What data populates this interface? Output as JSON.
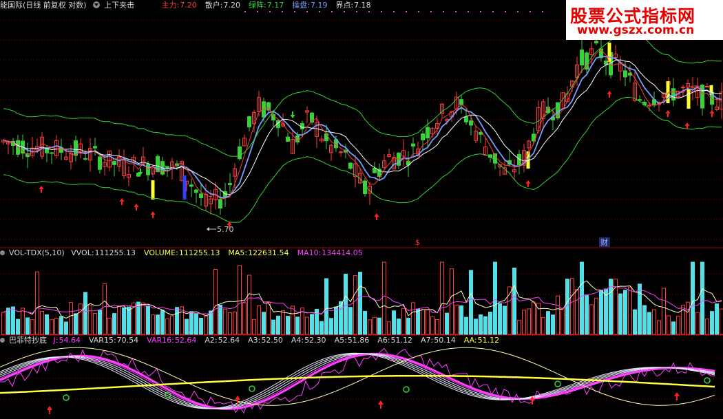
{
  "header": {
    "title": "能国际(日线 前复权 对数)",
    "formula_name": "上下夹击",
    "readouts": [
      {
        "label": "主力:",
        "value": "7.20",
        "color": "#ff3c3c"
      },
      {
        "label": "散户:",
        "value": "7.20",
        "color": "#d8d8d8"
      },
      {
        "label": "绿阵:",
        "value": "7.17",
        "color": "#36d236"
      },
      {
        "label": "操盘:",
        "value": "7.19",
        "color": "#7aa0ff"
      },
      {
        "label": "界点:",
        "value": "7.18",
        "color": "#d8d8d8"
      }
    ]
  },
  "watermark": {
    "title": "股票公式指标网",
    "url": "www.gszx.com.cn"
  },
  "markers": {
    "low_label": "5.70",
    "event_s": "$",
    "event_cai": "财"
  },
  "volume_header": {
    "name": "VOL-TDX(5,10)",
    "items": [
      {
        "label": "VVOL:",
        "value": "111255.13",
        "color": "#d8d8d8"
      },
      {
        "label": "VOLUME:",
        "value": "111255.13",
        "color": "#ffff40"
      },
      {
        "label": "MA5:",
        "value": "122631.54",
        "color": "#ffff40"
      },
      {
        "label": "MA10:",
        "value": "134414.05",
        "color": "#ff40ff"
      }
    ]
  },
  "osc_header": {
    "name": "巴菲特抄底",
    "items": [
      {
        "label": "J:",
        "value": "54.64",
        "color": "#ff40ff"
      },
      {
        "label": "VAR15:",
        "value": "70.54",
        "color": "#d8d8d8"
      },
      {
        "label": "VAR16:",
        "value": "52.64",
        "color": "#ff40ff"
      },
      {
        "label": "A2:",
        "value": "52.64",
        "color": "#d8d8d8"
      },
      {
        "label": "A3:",
        "value": "52.50",
        "color": "#d8d8d8"
      },
      {
        "label": "A4:",
        "value": "52.30",
        "color": "#d8d8d8"
      },
      {
        "label": "A5:",
        "value": "51.86",
        "color": "#d8d8d8"
      },
      {
        "label": "A6:",
        "value": "51.12",
        "color": "#d8d8d8"
      },
      {
        "label": "A7:",
        "value": "50.14",
        "color": "#d8d8d8"
      },
      {
        "label": "AA:",
        "value": "51.12",
        "color": "#ffff40"
      }
    ]
  },
  "chart_data": [
    {
      "type": "candlestick",
      "series": [
        {
          "name": "主力",
          "color": "#ff3c3c",
          "last": 7.2
        },
        {
          "name": "散户",
          "color": "#d8d8d8",
          "last": 7.2
        },
        {
          "name": "绿阵",
          "color": "#36d236",
          "last": 7.17
        },
        {
          "name": "操盘",
          "color": "#7aa0ff",
          "last": 7.19
        },
        {
          "name": "界点",
          "color": "#d8d8d8",
          "last": 7.18
        }
      ],
      "low_annotation": 5.7,
      "scale": "log"
    },
    {
      "type": "bar",
      "series": [
        {
          "name": "VVOL",
          "last": 111255.13
        },
        {
          "name": "VOLUME",
          "last": 111255.13
        },
        {
          "name": "MA5",
          "last": 122631.54
        },
        {
          "name": "MA10",
          "last": 134414.05
        }
      ]
    },
    {
      "type": "line",
      "series": [
        {
          "name": "J",
          "last": 54.64
        },
        {
          "name": "VAR15",
          "last": 70.54
        },
        {
          "name": "VAR16",
          "last": 52.64
        },
        {
          "name": "A2",
          "last": 52.64
        },
        {
          "name": "A3",
          "last": 52.5
        },
        {
          "name": "A4",
          "last": 52.3
        },
        {
          "name": "A5",
          "last": 51.86
        },
        {
          "name": "A6",
          "last": 51.12
        },
        {
          "name": "A7",
          "last": 50.14
        },
        {
          "name": "AA",
          "last": 51.12
        }
      ]
    }
  ],
  "colors": {
    "up": "#ff3c3c",
    "down": "#54e0e8",
    "grid": "#8b0000",
    "ma": "#ffffff",
    "green": "#36d236",
    "blue": "#7aa0ff",
    "yellow": "#ffff40",
    "magenta": "#ff40ff"
  }
}
